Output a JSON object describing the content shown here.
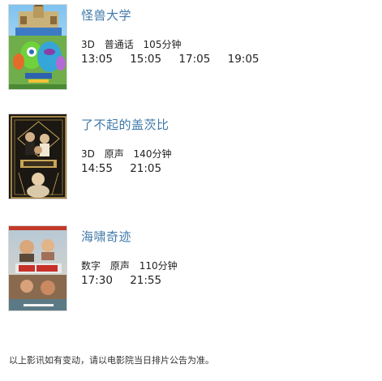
{
  "movies": [
    {
      "title": "怪兽大学",
      "format": "3D",
      "language": "普通话",
      "duration": "105分钟",
      "showtimes": [
        "13:05",
        "15:05",
        "17:05",
        "19:05"
      ]
    },
    {
      "title": "了不起的盖茨比",
      "format": "3D",
      "language": "原声",
      "duration": "140分钟",
      "showtimes": [
        "14:55",
        "21:05"
      ]
    },
    {
      "title": "海啸奇迹",
      "format": "数字",
      "language": "原声",
      "duration": "110分钟",
      "showtimes": [
        "17:30",
        "21:55"
      ]
    }
  ],
  "footer_notice": "以上影讯如有变动，请以电影院当日排片公告为准。"
}
